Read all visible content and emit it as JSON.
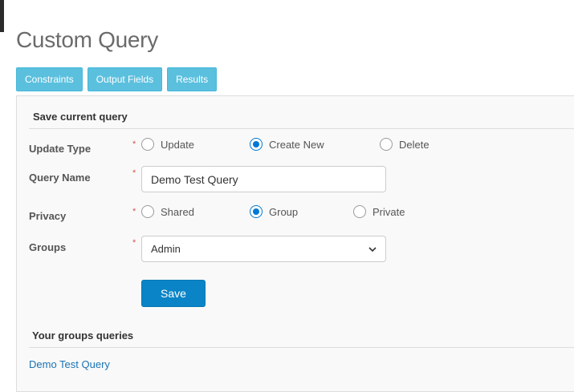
{
  "page": {
    "title": "Custom Query"
  },
  "tabs": [
    {
      "label": "Constraints"
    },
    {
      "label": "Output Fields"
    },
    {
      "label": "Results"
    }
  ],
  "save_section": {
    "heading": "Save current query",
    "update_type": {
      "label": "Update Type",
      "options": [
        {
          "label": "Update",
          "checked": false
        },
        {
          "label": "Create New",
          "checked": true
        },
        {
          "label": "Delete",
          "checked": false
        }
      ]
    },
    "query_name": {
      "label": "Query Name",
      "value": "Demo Test Query"
    },
    "privacy": {
      "label": "Privacy",
      "options": [
        {
          "label": "Shared",
          "checked": false
        },
        {
          "label": "Group",
          "checked": true
        },
        {
          "label": "Private",
          "checked": false
        }
      ]
    },
    "groups": {
      "label": "Groups",
      "selected": "Admin"
    },
    "save_label": "Save",
    "required_marker": "*"
  },
  "groups_section": {
    "heading": "Your groups queries",
    "items": [
      {
        "label": "Demo Test Query"
      }
    ]
  },
  "colors": {
    "tab_bg": "#5bc0de",
    "primary_button": "#0a84c6",
    "radio_checked": "#0078d4",
    "link": "#1a73b5",
    "required": "#d9534f"
  }
}
